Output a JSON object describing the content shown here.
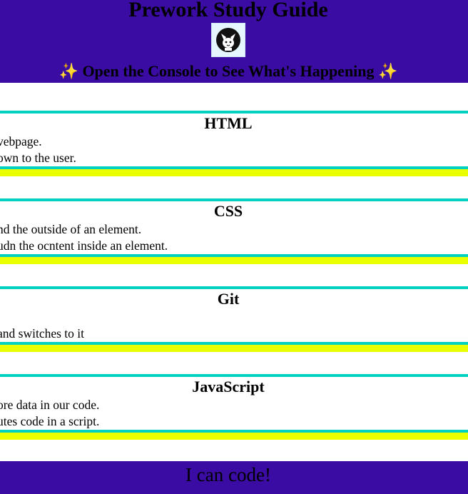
{
  "header": {
    "title": "Prework Study Guide",
    "subtitle_text": "Open the Console to See What's Happening",
    "sparkle_glyph": "✨",
    "background_color": "#3a0ca3"
  },
  "avatar": {
    "icon": "cat-avatar-icon"
  },
  "sections": [
    {
      "title": "HTML",
      "lines": [
        "vebpage.",
        "own to the user."
      ]
    },
    {
      "title": "CSS",
      "lines": [
        "nd the outside of an element.",
        "udn the ocntent inside an element."
      ]
    },
    {
      "title": "Git",
      "lines": [
        "",
        " and switches to it"
      ]
    },
    {
      "title": "JavaScript",
      "lines": [
        "ore data in our code.",
        "utes code in a script."
      ]
    }
  ],
  "colors": {
    "accent_cyan": "#00d1c1",
    "accent_yellow": "#eaff00"
  },
  "footer": {
    "text": "I can code!"
  }
}
